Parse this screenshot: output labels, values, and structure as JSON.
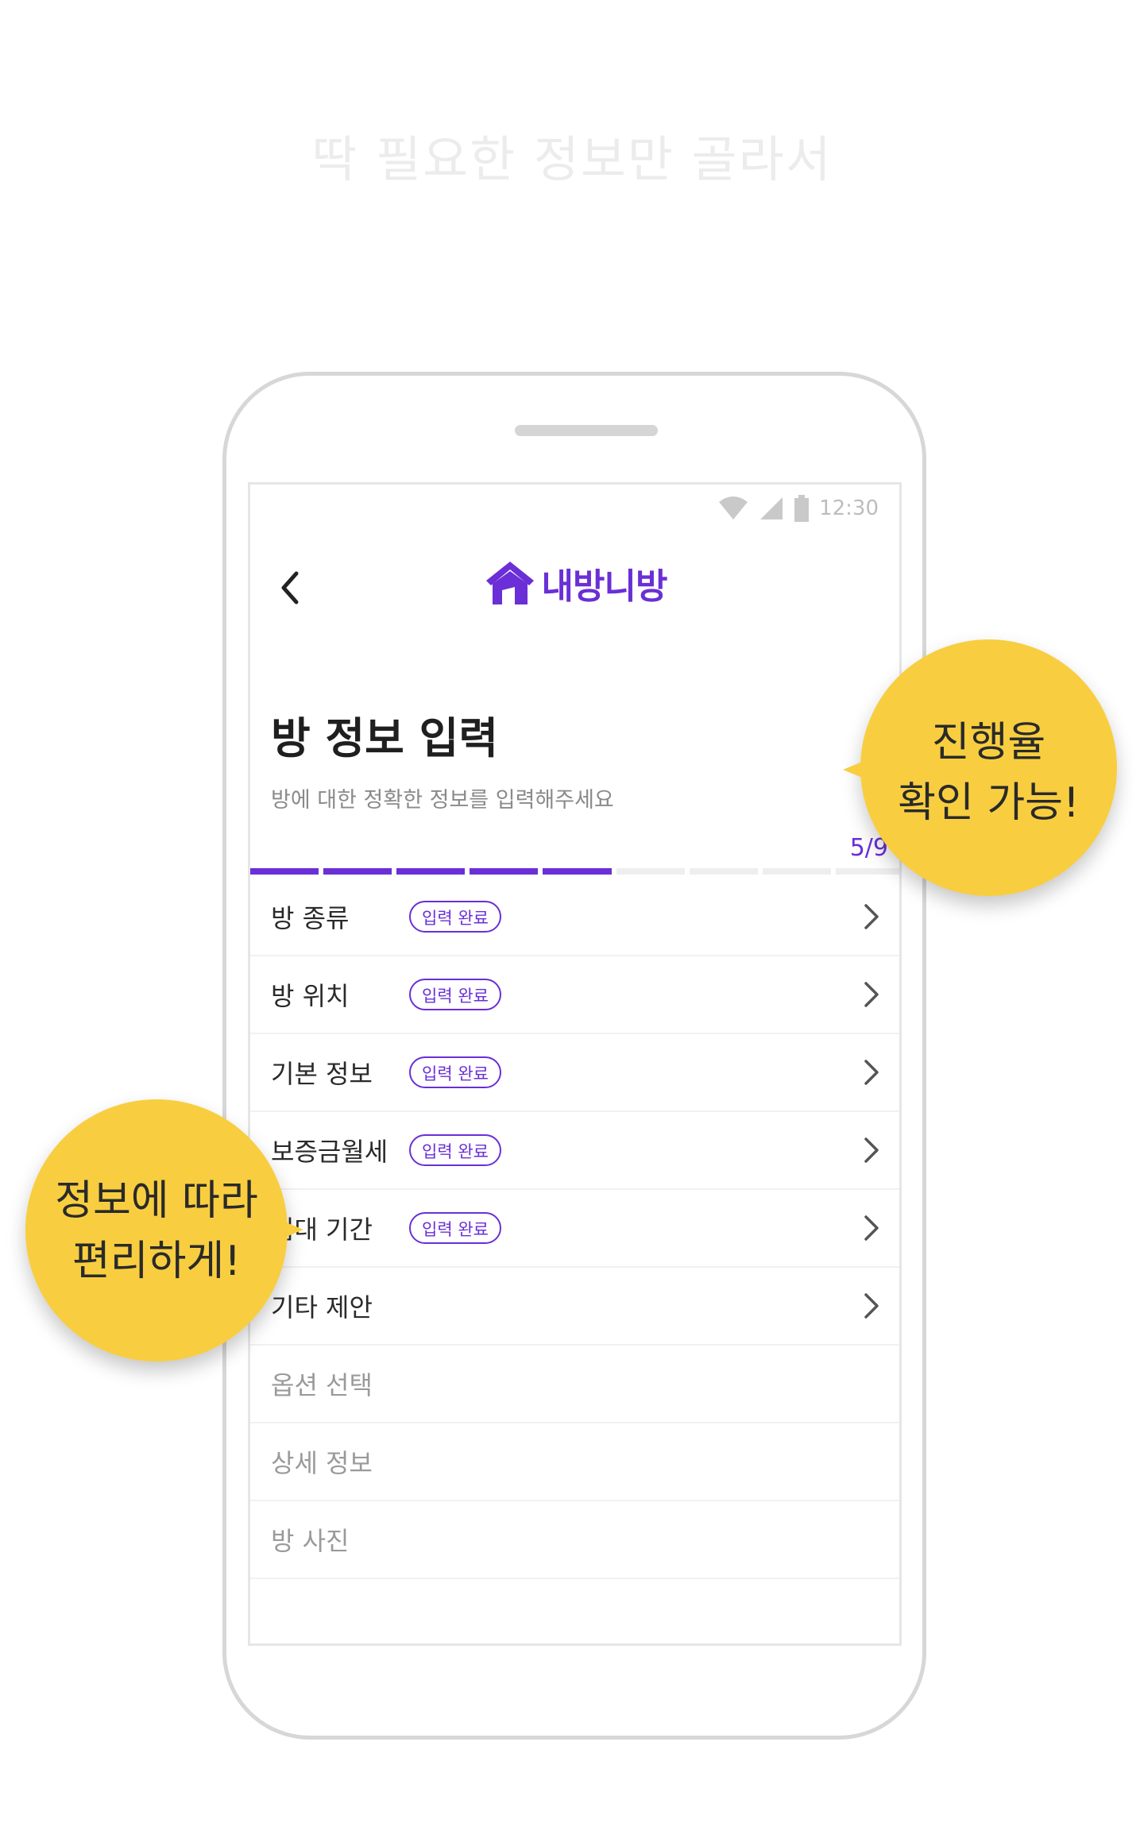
{
  "headline": "딱 필요한 정보만 골라서",
  "status_bar": {
    "time": "12:30",
    "icons": [
      "wifi-icon",
      "signal-icon",
      "battery-icon"
    ]
  },
  "header": {
    "back_icon": "chevron-left-icon",
    "logo_text": "내방니방",
    "logo_icon": "house-icon"
  },
  "page": {
    "title": "방 정보 입력",
    "subtitle": "방에 대한 정확한 정보를 입력해주세요"
  },
  "progress": {
    "label": "5/9",
    "current": 5,
    "total": 9
  },
  "items": [
    {
      "label": "방 종류",
      "badge": "입력 완료",
      "enabled": true
    },
    {
      "label": "방 위치",
      "badge": "입력 완료",
      "enabled": true
    },
    {
      "label": "기본 정보",
      "badge": "입력 완료",
      "enabled": true
    },
    {
      "label": "보증금월세",
      "badge": "입력 완료",
      "enabled": true
    },
    {
      "label": "임대 기간",
      "badge": "입력 완료",
      "enabled": true
    },
    {
      "label": "기타 제안",
      "badge": "",
      "enabled": true
    },
    {
      "label": "옵션 선택",
      "badge": "",
      "enabled": false
    },
    {
      "label": "상세 정보",
      "badge": "",
      "enabled": false
    },
    {
      "label": "방 사진",
      "badge": "",
      "enabled": false
    }
  ],
  "callouts": {
    "right": {
      "line1": "진행율",
      "line2": "확인 가능!"
    },
    "left": {
      "line1": "정보에 따라",
      "line2": "편리하게!"
    }
  },
  "colors": {
    "accent": "#6a2fd6",
    "callout": "#f8ce40",
    "inactive_segment": "#eeeeee"
  }
}
